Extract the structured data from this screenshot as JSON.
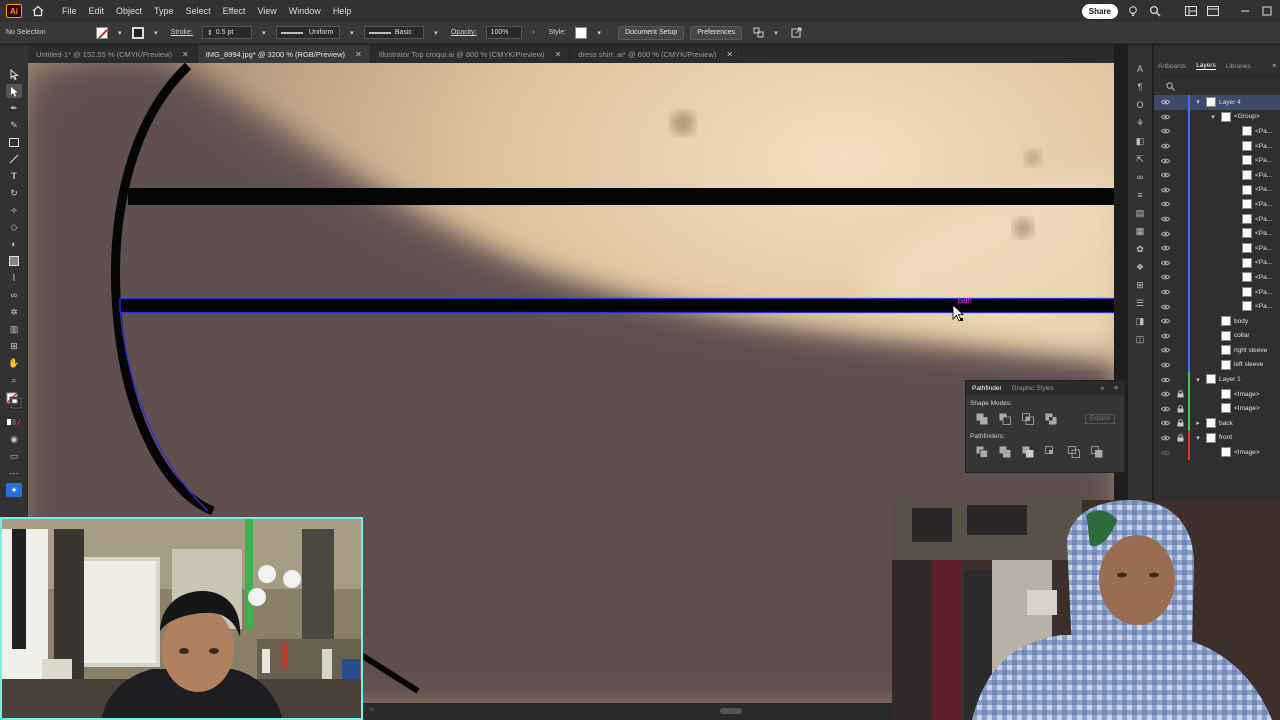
{
  "app": {
    "logo": "Ai"
  },
  "menu": [
    "File",
    "Edit",
    "Object",
    "Type",
    "Select",
    "Effect",
    "View",
    "Window",
    "Help"
  ],
  "menubar_right": {
    "share_label": "Share"
  },
  "control_bar": {
    "selection": "No Selection",
    "stroke_label": "Stroke:",
    "stroke_weight": "0.5 pt",
    "profile": "Uniform",
    "brush": "Basic",
    "opacity_label": "Opacity:",
    "opacity_value": "100%",
    "style_label": "Style:",
    "document_setup": "Document Setup",
    "preferences": "Preferences"
  },
  "tabs": [
    {
      "label": "Untitled-1* @ 152.55 % (CMYK/Preview)",
      "active": false
    },
    {
      "label": "IMG_8994.jpg* @ 3200 % (RGB/Preview)",
      "active": true
    },
    {
      "label": "Illustrator Top croqui.ai @ 800 % (CMYK/Preview)",
      "active": false
    },
    {
      "label": "dress shirt .ai* @ 600 % (CMYK/Preview)",
      "active": false
    }
  ],
  "canvas": {
    "hover_label": "path"
  },
  "panel_tabs": [
    "Artboards",
    "Layers",
    "Libraries"
  ],
  "layers": [
    {
      "name": "Layer 4",
      "depth": 0,
      "chevron": "down",
      "color": "#4b6bff",
      "selected": true
    },
    {
      "name": "<Group>",
      "depth": 1,
      "chevron": "down",
      "color": "#4b6bff"
    },
    {
      "name": "<Pa...",
      "depth": 2,
      "color": "#4b6bff"
    },
    {
      "name": "<Pa...",
      "depth": 2,
      "color": "#4b6bff"
    },
    {
      "name": "<Pa...",
      "depth": 2,
      "color": "#4b6bff"
    },
    {
      "name": "<Pa...",
      "depth": 2,
      "color": "#4b6bff"
    },
    {
      "name": "<Pa...",
      "depth": 2,
      "color": "#4b6bff"
    },
    {
      "name": "<Pa...",
      "depth": 2,
      "color": "#4b6bff"
    },
    {
      "name": "<Pa...",
      "depth": 2,
      "color": "#4b6bff"
    },
    {
      "name": "<Pa...",
      "depth": 2,
      "color": "#4b6bff"
    },
    {
      "name": "<Pa...",
      "depth": 2,
      "color": "#4b6bff"
    },
    {
      "name": "<Pa...",
      "depth": 2,
      "color": "#4b6bff"
    },
    {
      "name": "<Pa...",
      "depth": 2,
      "color": "#4b6bff"
    },
    {
      "name": "<Pa...",
      "depth": 2,
      "color": "#4b6bff"
    },
    {
      "name": "<Pa...",
      "depth": 2,
      "color": "#4b6bff"
    },
    {
      "name": "body",
      "depth": 1,
      "color": "#4b6bff"
    },
    {
      "name": "collar",
      "depth": 1,
      "color": "#4b6bff"
    },
    {
      "name": "right sleeve",
      "depth": 1,
      "color": "#4b6bff"
    },
    {
      "name": "left sleeve",
      "depth": 1,
      "color": "#4b6bff"
    },
    {
      "name": "Layer 1",
      "depth": 0,
      "chevron": "down",
      "color": "#43c84b"
    },
    {
      "name": "<Image>",
      "depth": 1,
      "color": "#43c84b",
      "locked": true
    },
    {
      "name": "<Image>",
      "depth": 1,
      "color": "#43c84b",
      "locked": true
    },
    {
      "name": "back",
      "depth": 0,
      "chevron": "right",
      "color": "#43c84b",
      "locked": true
    },
    {
      "name": "front",
      "depth": 0,
      "chevron": "down",
      "color": "#e03030",
      "locked": true
    },
    {
      "name": "<Image>",
      "depth": 1,
      "color": "#e03030",
      "dim": true
    }
  ],
  "pathfinder": {
    "tabs": [
      "Pathfinder",
      "Graphic Styles"
    ],
    "shape_modes_label": "Shape Modes:",
    "pathfinders_label": "Pathfinders:",
    "expand_label": "Expand"
  }
}
